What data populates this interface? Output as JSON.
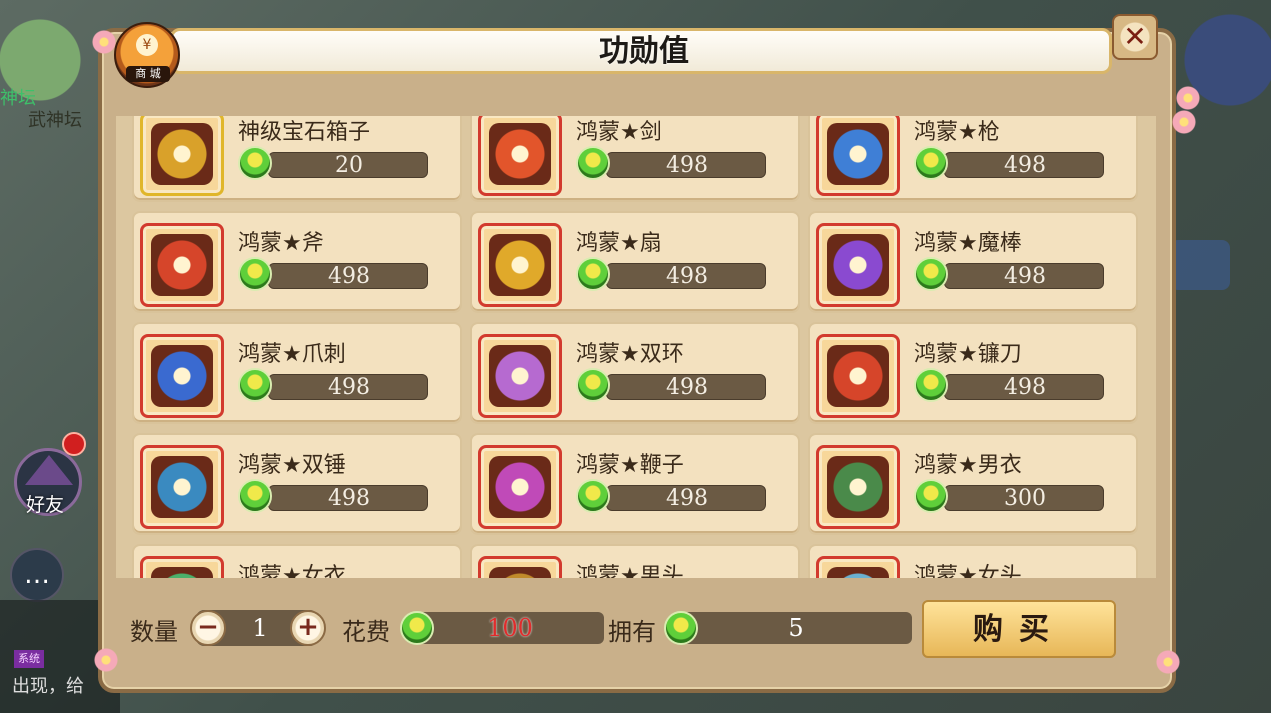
{
  "background": {
    "left_text_1": "神坛",
    "left_text_2": "武神坛",
    "friend_label": "好友",
    "chat_icon": "…",
    "system_tag": "系统",
    "chat_line": "出现，给"
  },
  "window": {
    "title": "功勋值",
    "shop_label": "商 城",
    "shop_coin": "¥",
    "close_icon": "✕"
  },
  "items": [
    {
      "name": "神级宝石箱子",
      "price": "20",
      "frame": "gold",
      "color": "#d9a12a"
    },
    {
      "name": "鸿蒙★剑",
      "price": "498",
      "frame": "red",
      "color": "#e2552b"
    },
    {
      "name": "鸿蒙★枪",
      "price": "498",
      "frame": "red",
      "color": "#3f7fd6"
    },
    {
      "name": "鸿蒙★斧",
      "price": "498",
      "frame": "red",
      "color": "#d6452a"
    },
    {
      "name": "鸿蒙★扇",
      "price": "498",
      "frame": "red",
      "color": "#e0a92a"
    },
    {
      "name": "鸿蒙★魔棒",
      "price": "498",
      "frame": "red",
      "color": "#8a4ad0"
    },
    {
      "name": "鸿蒙★爪刺",
      "price": "498",
      "frame": "red",
      "color": "#3a6ad0"
    },
    {
      "name": "鸿蒙★双环",
      "price": "498",
      "frame": "red",
      "color": "#b66ad0"
    },
    {
      "name": "鸿蒙★镰刀",
      "price": "498",
      "frame": "red",
      "color": "#d6452a"
    },
    {
      "name": "鸿蒙★双锤",
      "price": "498",
      "frame": "red",
      "color": "#3a8ac0"
    },
    {
      "name": "鸿蒙★鞭子",
      "price": "498",
      "frame": "red",
      "color": "#c04ab8"
    },
    {
      "name": "鸿蒙★男衣",
      "price": "300",
      "frame": "red",
      "color": "#4a8a4a"
    },
    {
      "name": "鸿蒙★女衣",
      "price": "",
      "frame": "red",
      "color": "#4ab06a"
    },
    {
      "name": "鸿蒙★男头",
      "price": "",
      "frame": "red",
      "color": "#c08a2a"
    },
    {
      "name": "鸿蒙★女头",
      "price": "",
      "frame": "red",
      "color": "#6ab0d0"
    }
  ],
  "footer": {
    "quantity_label": "数量",
    "quantity_value": "1",
    "minus": "−",
    "plus": "+",
    "cost_label": "花费",
    "cost_value": "100",
    "owned_label": "拥有",
    "owned_value": "5",
    "buy_label": "购买"
  },
  "colors": {
    "panel": "#c9b08a",
    "card": "#f3e1bf",
    "price_bar": "#6b5a44",
    "cost_text": "#e02c2c"
  }
}
